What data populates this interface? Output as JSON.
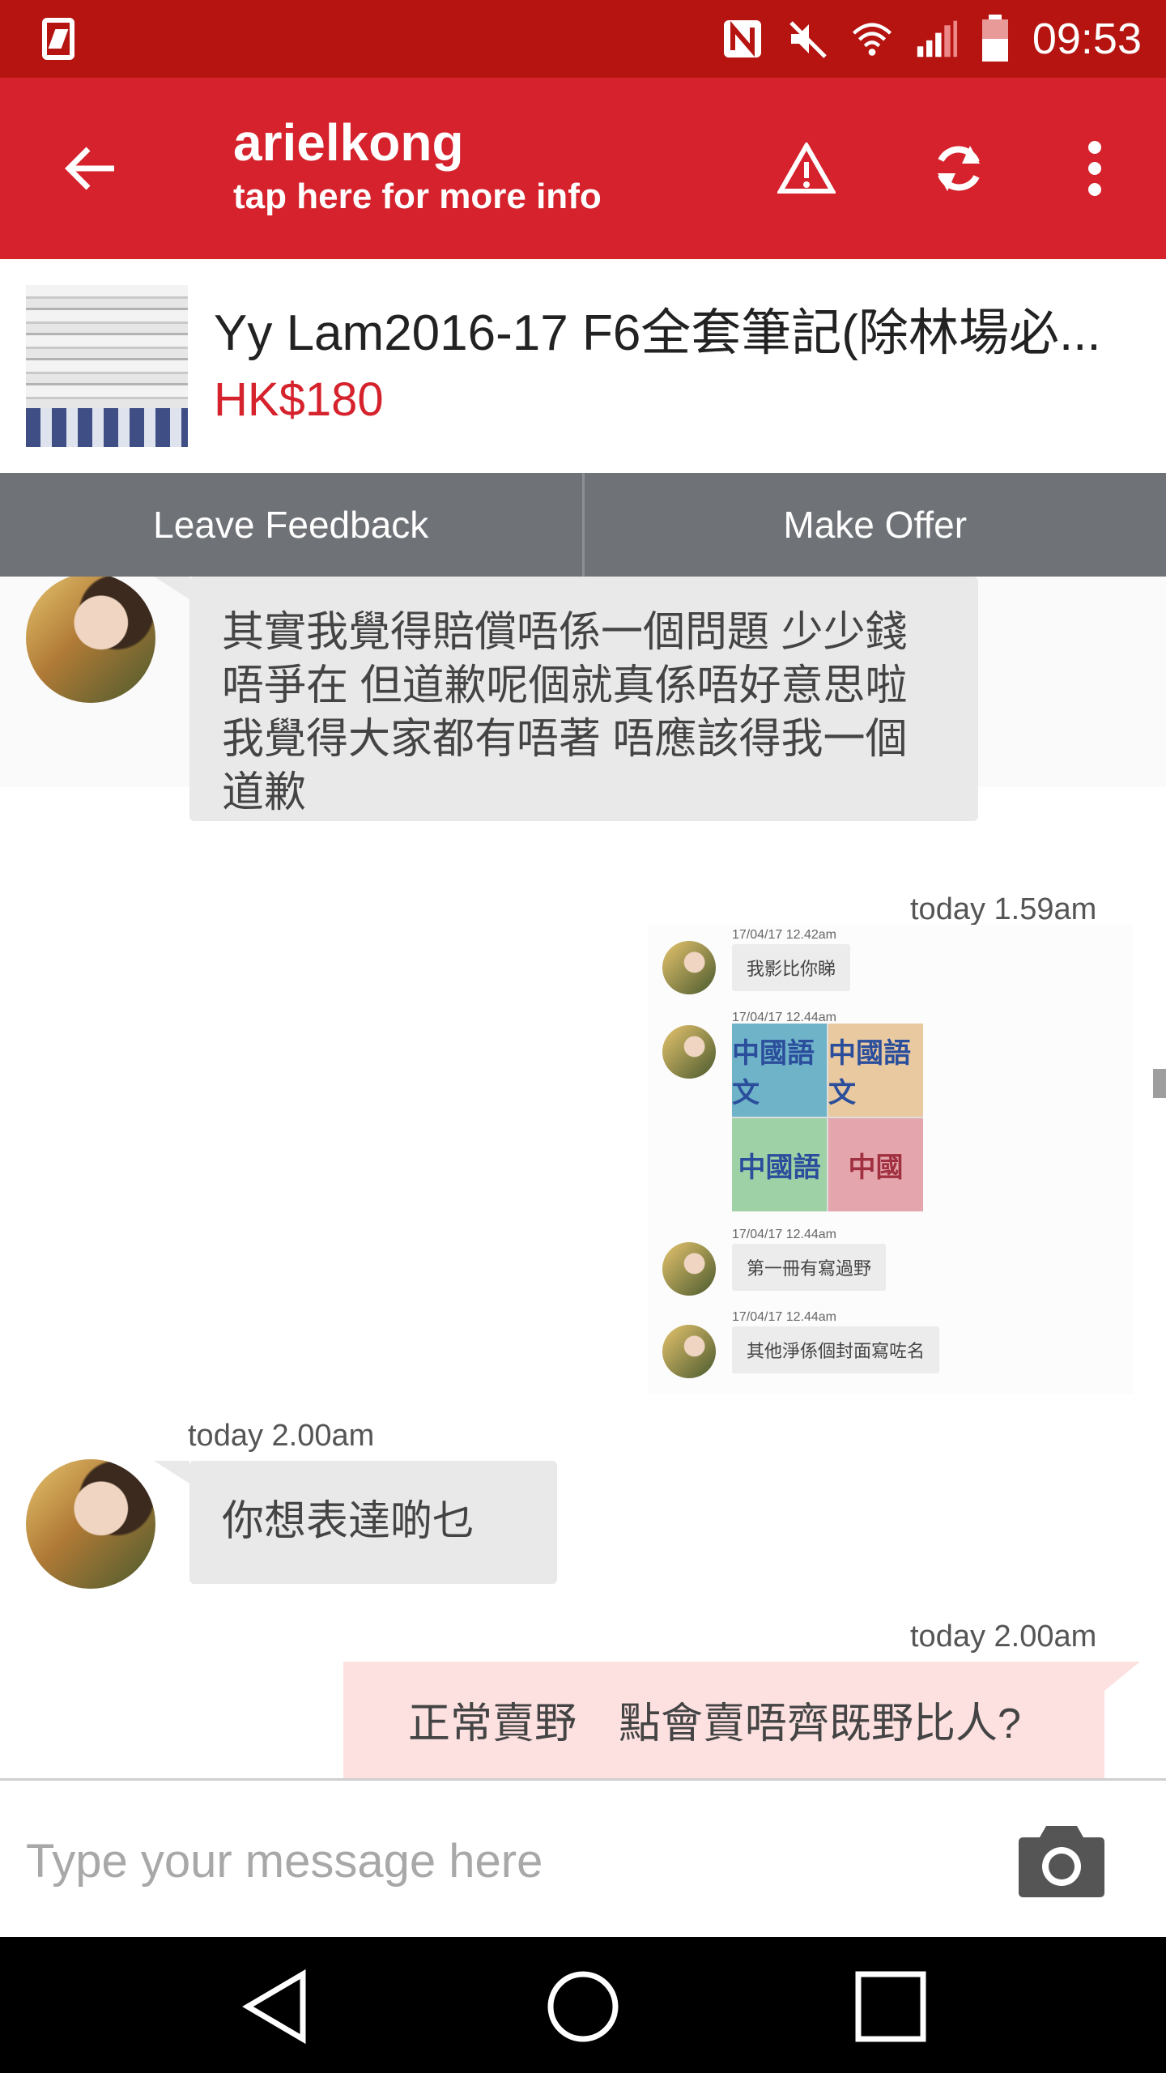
{
  "status_bar": {
    "time": "09:53",
    "icons": [
      "phone-screen-icon",
      "nfc-icon",
      "mute-icon",
      "wifi-icon",
      "signal-icon",
      "battery-icon"
    ]
  },
  "app_bar": {
    "title": "arielkong",
    "subtitle": "tap here for more info",
    "icons": [
      "back-arrow-icon",
      "warning-icon",
      "refresh-icon",
      "more-vert-icon"
    ]
  },
  "product": {
    "title": "Yy Lam2016-17 F6全套筆記(除林場必...",
    "price": "HK$180"
  },
  "actions": {
    "leave_feedback": "Leave Feedback",
    "make_offer": "Make Offer"
  },
  "messages": [
    {
      "side": "incoming",
      "text": "其實我覺得賠償唔係一個問題 少少錢唔爭在 但道歉呢個就真係唔好意思啦 我覺得大家都有唔著 唔應該得我一個道歉"
    },
    {
      "side": "outgoing",
      "timestamp": "today 1.59am",
      "screenshot": {
        "items": [
          {
            "ts": "17/04/17 12.42am",
            "text": "我影比你睇"
          },
          {
            "ts": "17/04/17 12.44am",
            "image_labels": [
              "中國語文",
              "中國語文",
              "中國語",
              "中國"
            ]
          },
          {
            "ts": "17/04/17 12.44am",
            "text": "第一冊有寫過野"
          },
          {
            "ts": "17/04/17 12.44am",
            "text": "其他淨係個封面寫咗名"
          }
        ]
      }
    },
    {
      "side": "incoming",
      "timestamp": "today 2.00am",
      "text": "你想表達啲乜"
    },
    {
      "side": "outgoing",
      "timestamp": "today 2.00am",
      "text": "正常賣野　點會賣唔齊既野比人?"
    }
  ],
  "composer": {
    "placeholder": "Type your message here",
    "camera_icon": "camera-icon"
  },
  "nav_bar": {
    "icons": [
      "back-triangle-icon",
      "home-circle-icon",
      "recents-square-icon"
    ]
  },
  "colors": {
    "status_bar": "#b51410",
    "app_bar": "#d5222c",
    "price": "#d5222c",
    "action_bar": "#6f7277",
    "incoming_bubble": "#e9e9e9",
    "outgoing_bubble": "#fde1e1"
  }
}
